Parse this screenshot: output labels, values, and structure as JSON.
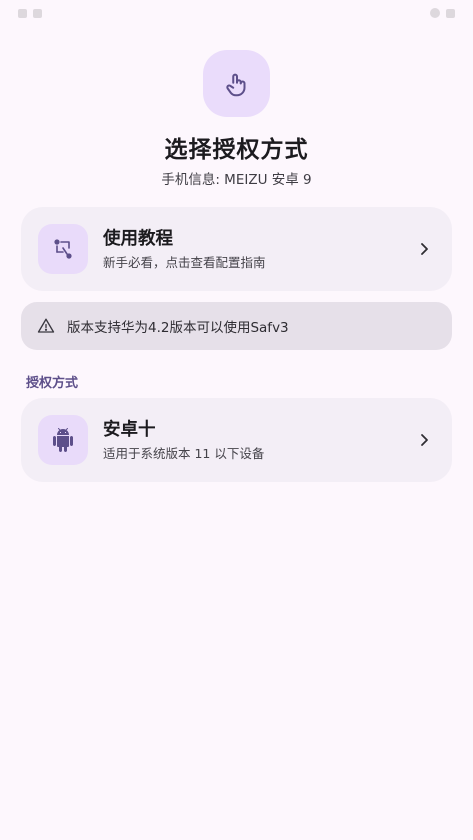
{
  "header": {
    "title": "选择授权方式",
    "device_info": "手机信息: MEIZU 安卓 9",
    "hero_icon": "touch-gesture-icon"
  },
  "cards": {
    "tutorial": {
      "title": "使用教程",
      "subtitle": "新手必看，点击查看配置指南",
      "icon": "tutorial-graph-icon"
    },
    "android": {
      "title": "安卓十",
      "subtitle": "适用于系统版本 11 以下设备",
      "icon": "android-icon"
    }
  },
  "notice": {
    "text": "版本支持华为4.2版本可以使用Safv3",
    "icon": "warning-icon"
  },
  "section": {
    "auth_methods_label": "授权方式"
  },
  "colors": {
    "background": "#fdf7fd",
    "card": "#f3eef6",
    "icon_bg": "#e9dbfa",
    "accent": "#5d4f8a",
    "notice": "#e6e0e9"
  }
}
